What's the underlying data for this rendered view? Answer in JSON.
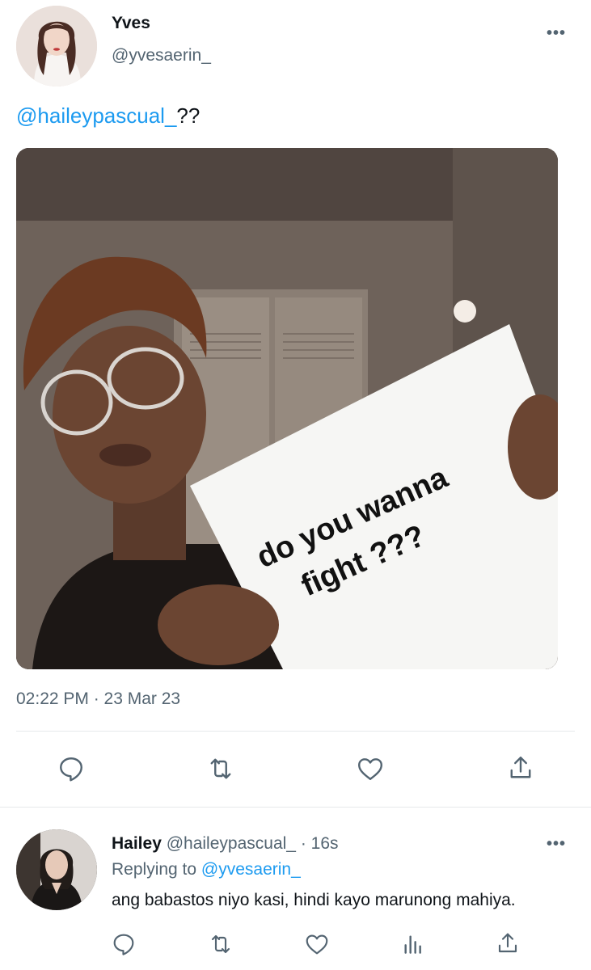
{
  "tweet": {
    "author_name": "Yves",
    "author_handle": "@yvesaerin_",
    "mention": "@haileypascual_",
    "text_suffix": "??",
    "image": {
      "sign_line1": "do you wanna",
      "sign_line2": "fight ???"
    },
    "timestamp": "02:22 PM · 23 Mar 23",
    "more": "•••"
  },
  "actions": {
    "icons": [
      "reply-icon",
      "retweet-icon",
      "like-icon",
      "share-icon"
    ]
  },
  "reply": {
    "author_name": "Hailey",
    "author_handle": "@haileypascual_",
    "time": "· 16s",
    "replying_label": "Replying to",
    "replying_handle": "@yvesaerin_",
    "text": "ang babastos niyo kasi, hindi kayo marunong mahiya.",
    "more": "•••",
    "icons": [
      "reply-icon",
      "retweet-icon",
      "like-icon",
      "analytics-icon",
      "share-icon"
    ]
  },
  "colors": {
    "link": "#1d9bf0",
    "secondary_text": "#536471"
  }
}
